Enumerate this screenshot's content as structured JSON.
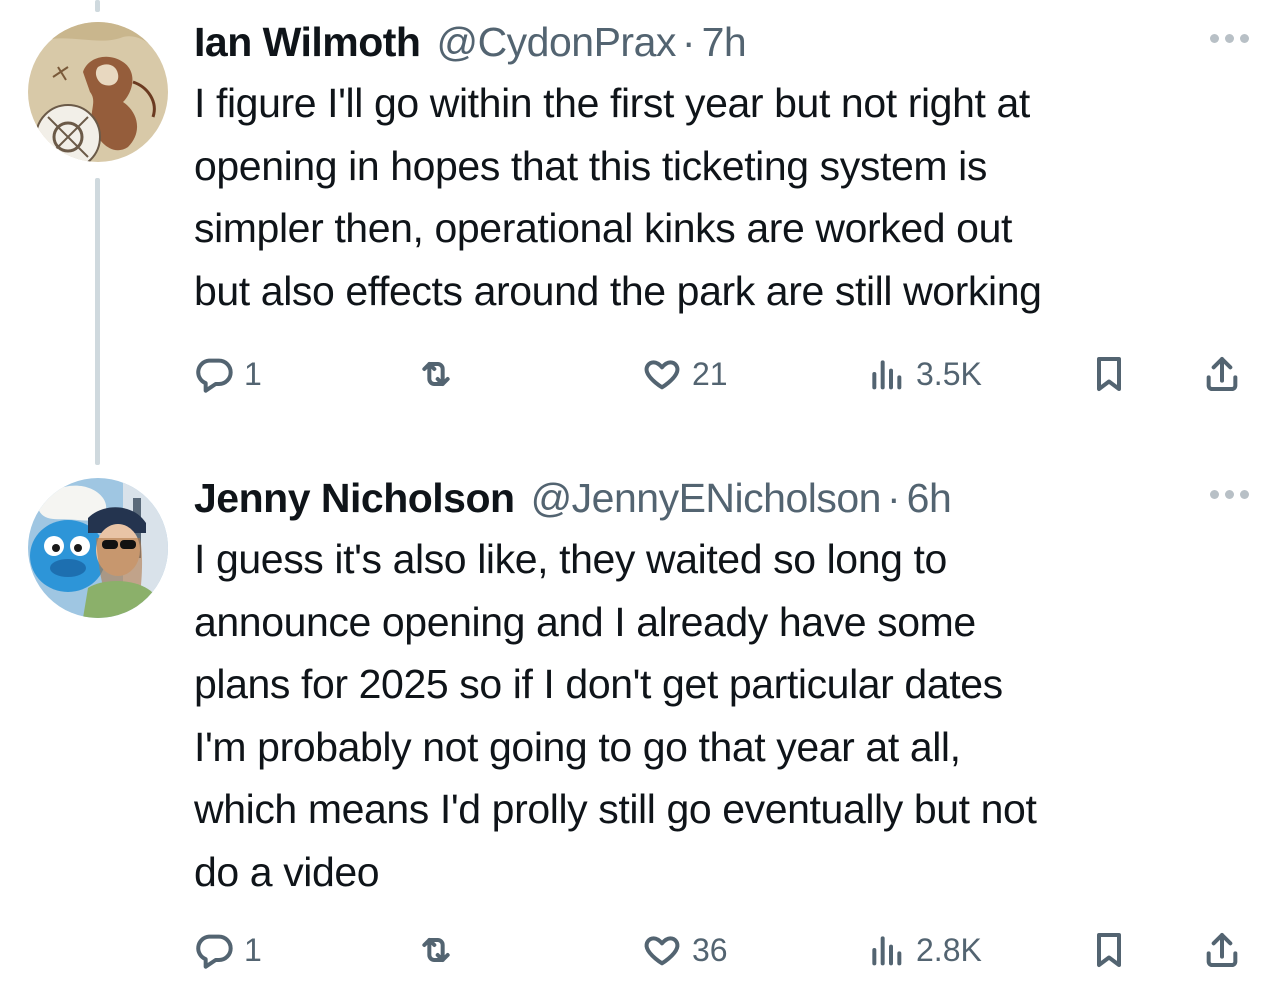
{
  "posts": [
    {
      "author_name": "Ian Wilmoth",
      "handle": "@CydonPrax",
      "separator": "·",
      "time": "7h",
      "text": "I figure I'll go within the first year but not right at\nopening in hopes that this ticketing system is\nsimpler then, operational kinks are worked out\nbut also effects around the park are still working",
      "replies": "1",
      "reposts": "",
      "likes": "21",
      "views": "3.5K",
      "avatar_icon": "illustrated-avatar"
    },
    {
      "author_name": "Jenny Nicholson",
      "handle": "@JennyENicholson",
      "separator": "·",
      "time": "6h",
      "text": "I guess it's also like, they waited so long to\nannounce opening and I already have some\nplans for 2025 so if I don't get particular dates\nI'm probably not going to go that year at all,\nwhich means I'd prolly still go eventually but not\ndo a video",
      "replies": "1",
      "reposts": "",
      "likes": "36",
      "views": "2.8K",
      "avatar_icon": "photo-avatar"
    }
  ],
  "colors": {
    "text": "#0f1419",
    "secondary": "#536471",
    "thread_line": "#cfd9de"
  },
  "icons": [
    "reply-icon",
    "repost-icon",
    "like-icon",
    "views-icon",
    "bookmark-icon",
    "share-icon",
    "more-options-icon"
  ]
}
